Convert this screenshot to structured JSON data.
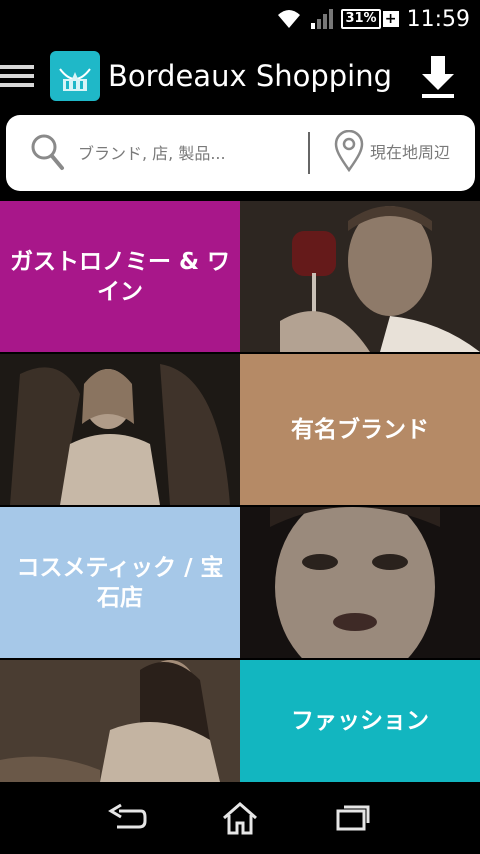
{
  "status_bar": {
    "battery_percent": "31%",
    "time": "11:59"
  },
  "app_bar": {
    "title": "Bordeaux Shopping"
  },
  "search": {
    "placeholder": "ブランド, 店, 製品...",
    "location_label": "現在地周辺"
  },
  "categories": [
    {
      "label": "ガストロノミー & ワイン",
      "color": "#a8178a"
    },
    {
      "label": "有名ブランド",
      "color": "#b58a66"
    },
    {
      "label": "コスメティック / 宝石店",
      "color": "#a6c8e8"
    },
    {
      "label": "ファッション",
      "color": "#12b6c0"
    }
  ],
  "icons": [
    "wifi-icon",
    "signal-icon",
    "battery-icon",
    "menu-icon",
    "download-icon",
    "search-icon",
    "location-pin-icon",
    "back-icon",
    "home-icon",
    "recents-icon"
  ]
}
